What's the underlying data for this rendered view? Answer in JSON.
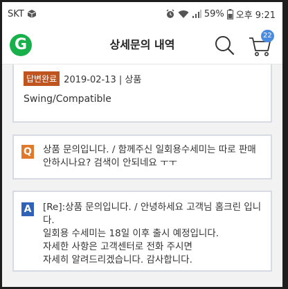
{
  "status_bar": {
    "carrier": "SKT",
    "battery": "59%",
    "time": "오후 9:21"
  },
  "header": {
    "logo_letter": "G",
    "title": "상세문의 내역",
    "cart_count": "22"
  },
  "inquiry": {
    "status_badge": "답변완료",
    "meta": "2019-02-13 | 상품",
    "product": "Swing/Compatible"
  },
  "question": {
    "icon_letter": "Q",
    "lines": [
      "상품 문의입니다. / 함께주신 일회용수세미는 따로 판매",
      "안하시나요? 검색이 안되네요 ㅜㅜ"
    ]
  },
  "answer": {
    "icon_letter": "A",
    "lines": [
      "[Re]:상품 문의입니다. / 안녕하세요 고객님 홈크린 입니",
      "다.",
      "일회용 수세미는 18일 이후 출시 예정입니다.",
      "자세한 사항은 고객센터로 전화 주시면",
      "자세히 알려드리겠습니다. 감사합니다."
    ]
  },
  "colors": {
    "brand_green": "#18b04a",
    "badge_answered": "#c0541e",
    "q_icon": "#e07a2a",
    "a_icon": "#2f62b8",
    "cart_badge": "#4a8be0"
  }
}
